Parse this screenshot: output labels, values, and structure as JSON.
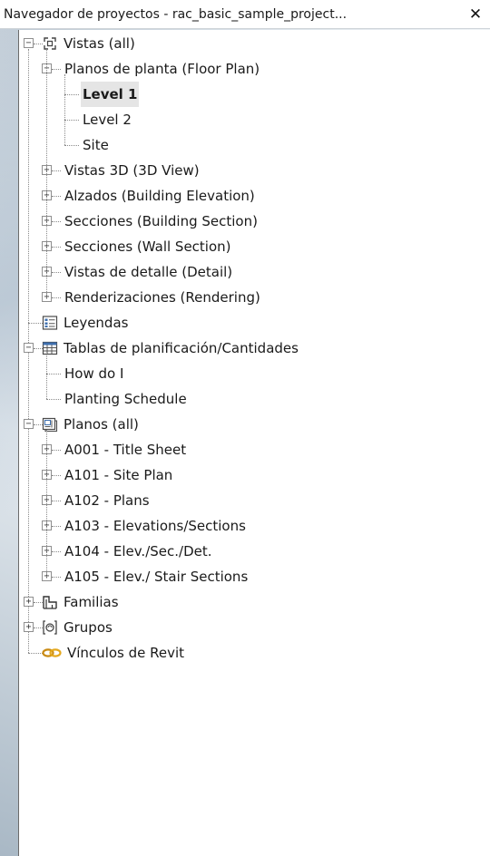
{
  "window": {
    "title": "Navegador de proyectos - rac_basic_sample_project...",
    "close_symbol": "✕"
  },
  "tree": [
    {
      "id": "vistas",
      "level": 0,
      "label": "Vistas (all)",
      "toggle": "-",
      "icon": "views-icon"
    },
    {
      "id": "planos-planta",
      "level": 1,
      "label": "Planos de planta (Floor Plan)",
      "toggle": "-"
    },
    {
      "id": "level-1",
      "level": 2,
      "label": "Level 1",
      "bold": true,
      "selected": true
    },
    {
      "id": "level-2",
      "level": 2,
      "label": "Level 2"
    },
    {
      "id": "site",
      "level": 2,
      "label": "Site",
      "last": true
    },
    {
      "id": "vistas-3d",
      "level": 1,
      "label": "Vistas 3D (3D View)",
      "toggle": "+"
    },
    {
      "id": "alzados",
      "level": 1,
      "label": "Alzados (Building Elevation)",
      "toggle": "+"
    },
    {
      "id": "secciones-building",
      "level": 1,
      "label": "Secciones (Building Section)",
      "toggle": "+"
    },
    {
      "id": "secciones-wall",
      "level": 1,
      "label": "Secciones (Wall Section)",
      "toggle": "+"
    },
    {
      "id": "vistas-detalle",
      "level": 1,
      "label": "Vistas de detalle (Detail)",
      "toggle": "+"
    },
    {
      "id": "renderizaciones",
      "level": 1,
      "label": "Renderizaciones (Rendering)",
      "toggle": "+",
      "last": true
    },
    {
      "id": "leyendas",
      "level": 0,
      "label": "Leyendas",
      "icon": "legend-icon"
    },
    {
      "id": "tablas",
      "level": 0,
      "label": "Tablas de planificación/Cantidades",
      "toggle": "-",
      "icon": "schedule-icon"
    },
    {
      "id": "how-do-i",
      "level": 1,
      "label": "How do I"
    },
    {
      "id": "planting-schedule",
      "level": 1,
      "label": "Planting Schedule",
      "last": true
    },
    {
      "id": "planos",
      "level": 0,
      "label": "Planos (all)",
      "toggle": "-",
      "icon": "sheets-icon"
    },
    {
      "id": "a001",
      "level": 1,
      "label": "A001 - Title Sheet",
      "toggle": "+"
    },
    {
      "id": "a101",
      "level": 1,
      "label": "A101 - Site Plan",
      "toggle": "+"
    },
    {
      "id": "a102",
      "level": 1,
      "label": "A102 - Plans",
      "toggle": "+"
    },
    {
      "id": "a103",
      "level": 1,
      "label": "A103 - Elevations/Sections",
      "toggle": "+"
    },
    {
      "id": "a104",
      "level": 1,
      "label": "A104 - Elev./Sec./Det.",
      "toggle": "+"
    },
    {
      "id": "a105",
      "level": 1,
      "label": "A105 - Elev./ Stair Sections",
      "toggle": "+",
      "last": true
    },
    {
      "id": "familias",
      "level": 0,
      "label": "Familias",
      "toggle": "+",
      "icon": "families-icon"
    },
    {
      "id": "grupos",
      "level": 0,
      "label": "Grupos",
      "toggle": "+",
      "icon": "groups-icon"
    },
    {
      "id": "vinculos",
      "level": 0,
      "label": "Vínculos de Revit",
      "icon": "revit-links-icon",
      "last": true
    }
  ]
}
